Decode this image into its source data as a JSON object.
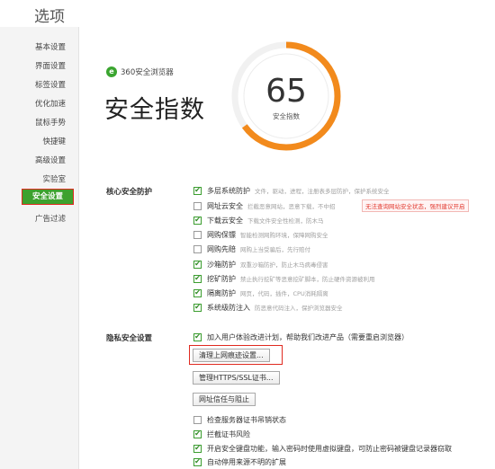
{
  "header": {
    "title": "选项"
  },
  "sidebar": {
    "items": [
      {
        "label": "基本设置"
      },
      {
        "label": "界面设置"
      },
      {
        "label": "标签设置"
      },
      {
        "label": "优化加速"
      },
      {
        "label": "鼠标手势"
      },
      {
        "label": "快捷键"
      },
      {
        "label": "高级设置"
      },
      {
        "label": "实验室"
      },
      {
        "label": "安全设置",
        "active": true
      },
      {
        "label": "广告过滤"
      }
    ]
  },
  "hero": {
    "brand_name": "360安全浏览器",
    "title": "安全指数",
    "score": "65",
    "score_label": "安全指数",
    "score_value_percent": 65
  },
  "core_section": {
    "title": "核心安全防护",
    "options": [
      {
        "label": "多层系统防护",
        "desc": "文件，驱动，进程，注册表多层防护，保护系统安全",
        "checked": true
      },
      {
        "label": "网址云安全",
        "desc": "拦截恶意网站，恶意下载，不中招",
        "checked": false
      },
      {
        "label": "下载云安全",
        "desc": "下载文件安全性检测，防木马",
        "checked": true
      },
      {
        "label": "网购保镖",
        "desc": "智能检测网购环境，保障网购安全",
        "checked": false
      },
      {
        "label": "网购先赔",
        "desc": "网购上当受骗后，先行赔付",
        "checked": false
      },
      {
        "label": "沙箱防护",
        "desc": "双重沙箱防护，防止木马病毒侵害",
        "checked": true
      },
      {
        "label": "挖矿防护",
        "desc": "禁止执行挖矿等恶意挖矿脚本，防止硬件资源被利用",
        "checked": true
      },
      {
        "label": "隔离防护",
        "desc": "网页，代码，插件，CPU消耗隔离",
        "checked": true
      },
      {
        "label": "系统级防注入",
        "desc": "防恶意代码注入，保护浏览器安全",
        "checked": true
      }
    ],
    "warning": "无法查询网站安全状态，强烈建议开启"
  },
  "privacy_section": {
    "title": "隐私安全设置",
    "improve_option": {
      "label": "加入用户体验改进计划，帮助我们改进产品（需要重启浏览器）",
      "checked": true
    },
    "buttons": {
      "clear_data": "清理上网痕迹设置...",
      "https_cert": "管理HTTPS/SSL证书...",
      "trust_block": "网址信任与阻止"
    },
    "options": [
      {
        "label": "检查服务器证书吊销状态",
        "checked": false
      },
      {
        "label": "拦截证书风险",
        "checked": true
      },
      {
        "label": "开启安全键盘功能，输入密码时使用虚拟键盘，可防止密码被键盘记录器窃取",
        "checked": true
      },
      {
        "label": "自动停用来源不明的扩展",
        "checked": true
      }
    ]
  },
  "colors": {
    "accent_green": "#3da12e",
    "highlight_red": "#e02a20",
    "gauge_orange": "#f28a1c",
    "gauge_orange_light": "#f6a13a"
  }
}
